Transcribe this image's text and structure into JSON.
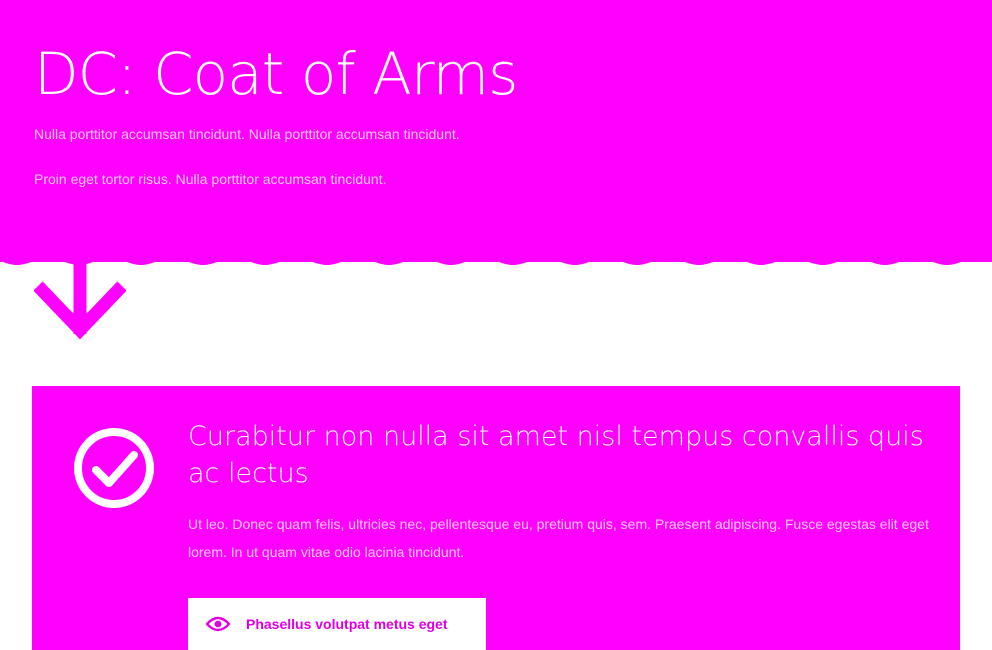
{
  "hero": {
    "title": "DC: Coat of Arms",
    "paragraphs": [
      "Nulla porttitor accumsan tincidunt. Nulla porttitor accumsan tincidunt.",
      "Proin eget tortor risus. Nulla porttitor accumsan tincidunt."
    ]
  },
  "feature": {
    "icon": "check-circle-icon",
    "title": "Curabitur non nulla sit amet nisl tempus convallis quis ac lectus",
    "body": "Ut leo. Donec quam felis, ultricies nec, pellentesque eu, pretium quis, sem. Praesent adipiscing. Fusce egestas elit eget lorem. In ut quam vitae odio lacinia tincidunt.",
    "button": {
      "icon": "eye-icon",
      "label": "Phasellus volutpat metus eget"
    }
  },
  "colors": {
    "accent": "#ff00ff",
    "background": "#ffffff",
    "button_text": "#e000e0"
  },
  "icons": {
    "scroll_indicator": "arrow-down-icon"
  }
}
